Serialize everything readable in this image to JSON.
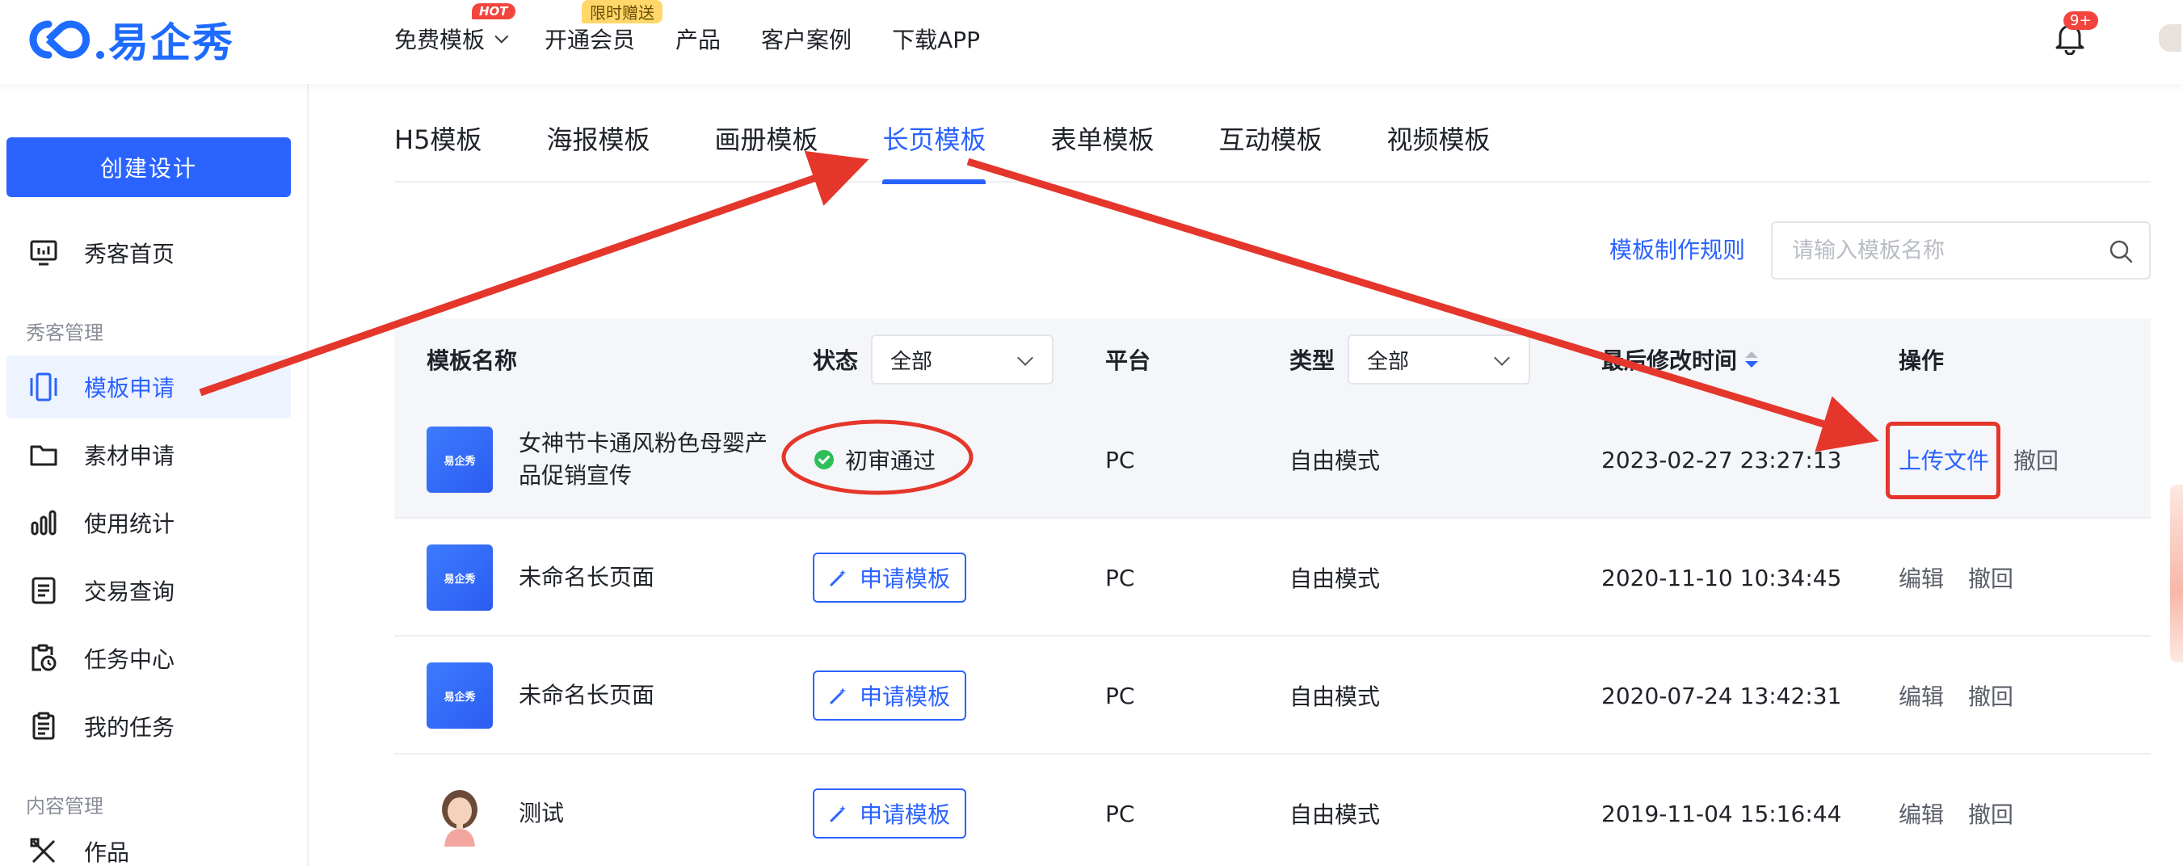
{
  "header": {
    "logo_text": "易企秀",
    "nav": [
      {
        "label": "免费模板",
        "badge": "HOT"
      },
      {
        "label": "开通会员",
        "badge": "限时赠送"
      },
      {
        "label": "产品"
      },
      {
        "label": "客户案例"
      },
      {
        "label": "下载APP"
      }
    ],
    "notification_count": "9+"
  },
  "sidebar": {
    "create_label": "创建设计",
    "home_label": "秀客首页",
    "section_manage": "秀客管理",
    "items_manage": [
      {
        "label": "模板申请",
        "icon": "template-icon"
      },
      {
        "label": "素材申请",
        "icon": "folder-icon"
      },
      {
        "label": "使用统计",
        "icon": "bar-chart-icon"
      },
      {
        "label": "交易查询",
        "icon": "receipt-icon"
      },
      {
        "label": "任务中心",
        "icon": "task-clock-icon"
      },
      {
        "label": "我的任务",
        "icon": "clipboard-icon"
      }
    ],
    "section_content": "内容管理",
    "items_content": [
      {
        "label": "作品",
        "icon": "works-icon"
      }
    ]
  },
  "tabs": [
    "H5模板",
    "海报模板",
    "画册模板",
    "长页模板",
    "表单模板",
    "互动模板",
    "视频模板"
  ],
  "active_tab": "长页模板",
  "toolbar": {
    "rules_link": "模板制作规则",
    "search_placeholder": "请输入模板名称"
  },
  "table": {
    "headers": {
      "name": "模板名称",
      "status": "状态",
      "platform": "平台",
      "type": "类型",
      "modified": "最后修改时间",
      "actions": "操作"
    },
    "status_filter": "全部",
    "type_filter": "全部",
    "rows": [
      {
        "thumb": "易企秀",
        "name": "女神节卡通风粉色母婴产品促销宣传",
        "status": "初审通过",
        "platform": "PC",
        "type": "自由模式",
        "modified": "2023-02-27 23:27:13",
        "action1": "上传文件",
        "action2": "撤回"
      },
      {
        "thumb": "易企秀",
        "name": "未命名长页面",
        "status": "申请模板",
        "platform": "PC",
        "type": "自由模式",
        "modified": "2020-11-10 10:34:45",
        "action1": "编辑",
        "action2": "撤回"
      },
      {
        "thumb": "易企秀",
        "name": "未命名长页面",
        "status": "申请模板",
        "platform": "PC",
        "type": "自由模式",
        "modified": "2020-07-24 13:42:31",
        "action1": "编辑",
        "action2": "撤回"
      },
      {
        "thumb": "",
        "name": "测试",
        "status": "申请模板",
        "platform": "PC",
        "type": "自由模式",
        "modified": "2019-11-04 15:16:44",
        "action1": "编辑",
        "action2": "撤回"
      }
    ]
  },
  "colors": {
    "primary": "#2b63ff",
    "annotation_red": "#e5362b",
    "success": "#2fbf5a"
  }
}
